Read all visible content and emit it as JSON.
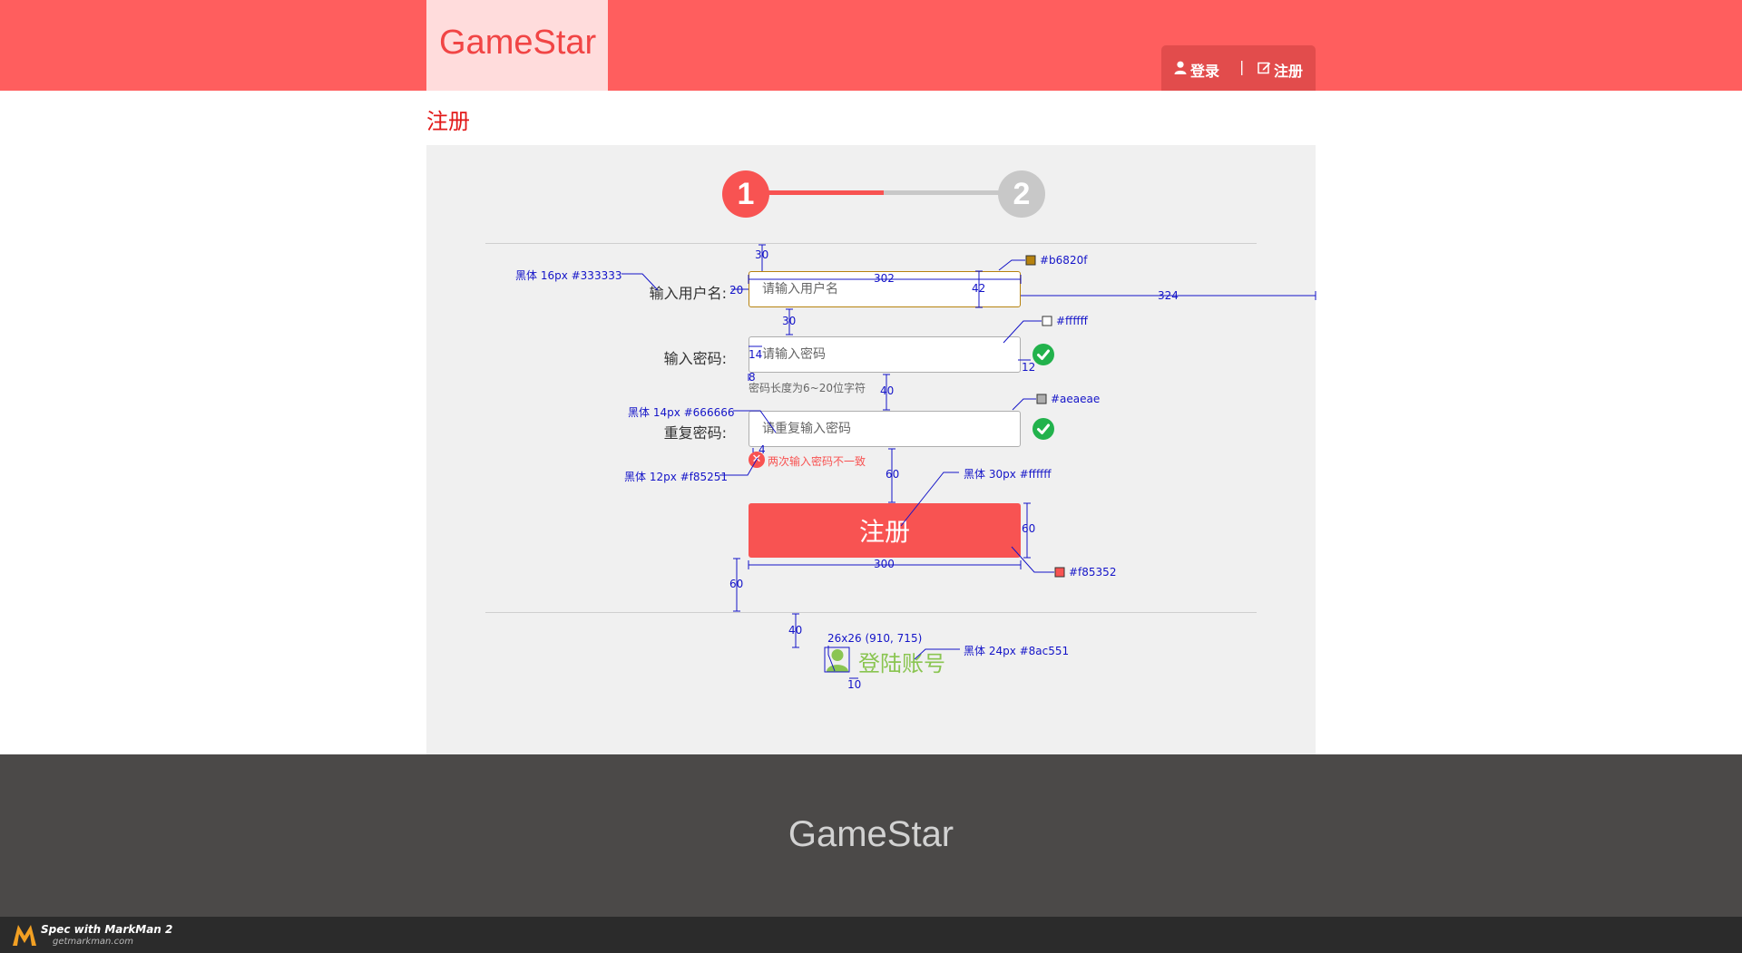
{
  "header": {
    "logo": "GameStar",
    "login": "登录",
    "divider": "|",
    "register": "注册"
  },
  "page": {
    "title": "注册"
  },
  "steps": {
    "step1": "1",
    "step2": "2"
  },
  "form": {
    "username": {
      "label": "输入用户名:",
      "placeholder": "请输入用户名"
    },
    "password": {
      "label": "输入密码:",
      "placeholder": "请输入密码",
      "hint": "密码长度为6~20位字符"
    },
    "confirm": {
      "label": "重复密码:",
      "placeholder": "请重复输入密码",
      "error": "两次输入密码不一致"
    },
    "submit": "注册"
  },
  "login_link": "登陆账号",
  "footer": {
    "logo": "GameStar"
  },
  "annotations": {
    "label_font": "黑体 16px  #333333",
    "color_border_active": "#b6820f",
    "color_bg": "#ffffff",
    "color_border": "#aeaeae",
    "input_font": "黑体 14px  #666666",
    "error_font": "黑体 12px #f85251",
    "button_font": "黑体 30px #ffffff",
    "button_color": "#f85352",
    "icon_spec": "26x26 (910, 715)",
    "link_font": "黑体 24px #8ac551",
    "d30a": "30",
    "d302": "302",
    "d42": "42",
    "d20": "20",
    "d324": "324",
    "d30b": "30",
    "d14": "14",
    "d12": "12",
    "d8": "8",
    "d40a": "40",
    "d4": "4",
    "d60a": "60",
    "d60b": "60",
    "d300": "300",
    "d60c": "60",
    "d40b": "40",
    "d10": "10"
  },
  "markman": {
    "title": "Spec with MarkMan 2",
    "url": "getmarkman.com"
  },
  "colors": {
    "header": "#ff5e5e",
    "logo_bg": "#ffdcdc",
    "accent": "#f85352",
    "step_inactive": "#c8c8c8",
    "success": "#22b24c",
    "link": "#8ac551",
    "footer": "#4b4948"
  }
}
